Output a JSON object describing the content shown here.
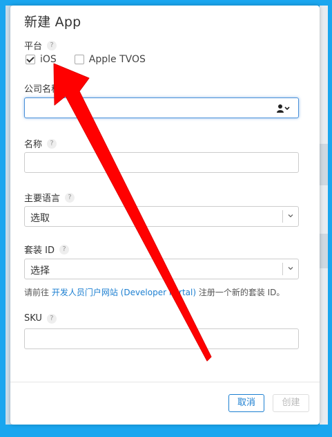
{
  "dialog": {
    "title": "新建 App"
  },
  "platform": {
    "label": "平台",
    "help": "?",
    "options": [
      {
        "label": "iOS",
        "checked": true
      },
      {
        "label": "Apple TVOS",
        "checked": false
      }
    ]
  },
  "company": {
    "label": "公司名称",
    "value": "",
    "icon": "user-dropdown-icon"
  },
  "name": {
    "label": "名称",
    "help": "?",
    "value": ""
  },
  "language": {
    "label": "主要语言",
    "help": "?",
    "selected": "选取"
  },
  "bundle": {
    "label": "套装 ID",
    "help": "?",
    "selected": "选择",
    "hint_prefix": "请前往 ",
    "hint_link": "开发人员门户网站 (Developer Portal)",
    "hint_suffix": " 注册一个新的套装 ID。"
  },
  "sku": {
    "label": "SKU",
    "help": "?",
    "value": ""
  },
  "buttons": {
    "cancel": "取消",
    "create": "创建"
  },
  "colors": {
    "frame": "#1aa6ef",
    "accent": "#1c7fd1",
    "annotation_arrow": "#ff0000"
  }
}
